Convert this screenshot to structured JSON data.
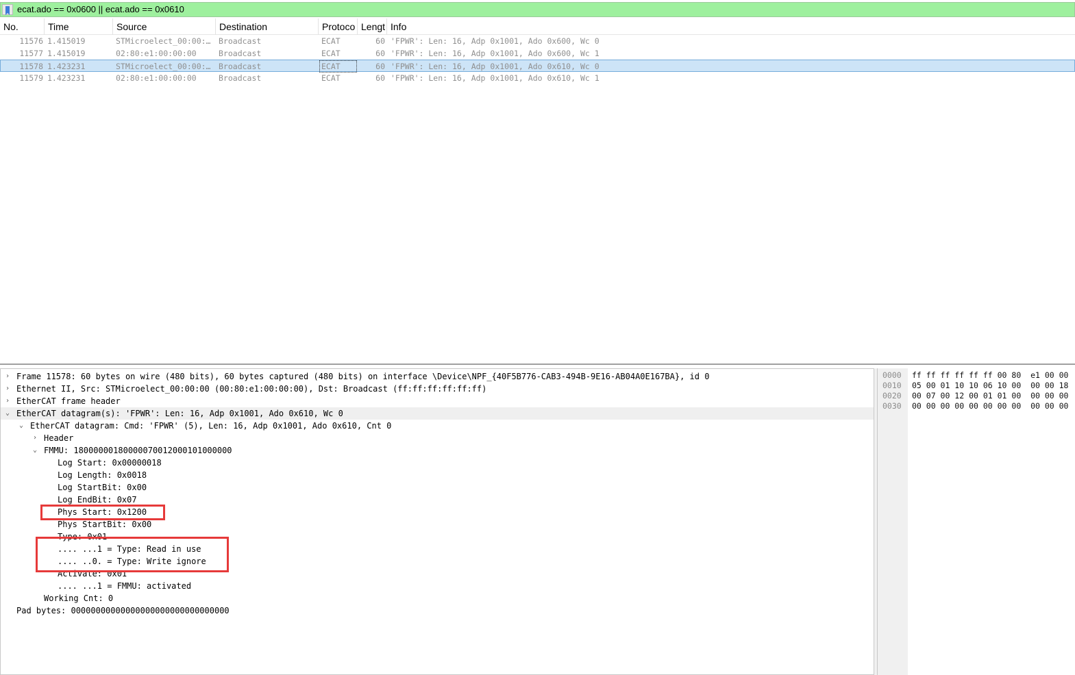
{
  "filter": {
    "value": "ecat.ado == 0x0600 || ecat.ado == 0x0610"
  },
  "columns": [
    "No.",
    "Time",
    "Source",
    "Destination",
    "Protoco",
    "Lengt",
    "Info"
  ],
  "packets": [
    {
      "no": "11576",
      "time": "1.415019",
      "source": "STMicroelect_00:00:…",
      "destination": "Broadcast",
      "protocol": "ECAT",
      "length": "60",
      "info": "'FPWR': Len: 16, Adp 0x1001, Ado 0x600, Wc 0"
    },
    {
      "no": "11577",
      "time": "1.415019",
      "source": "02:80:e1:00:00:00",
      "destination": "Broadcast",
      "protocol": "ECAT",
      "length": "60",
      "info": "'FPWR': Len: 16, Adp 0x1001, Ado 0x600, Wc 1"
    },
    {
      "no": "11578",
      "time": "1.423231",
      "source": "STMicroelect_00:00:…",
      "destination": "Broadcast",
      "protocol": "ECAT",
      "length": "60",
      "info": "'FPWR': Len: 16, Adp 0x1001, Ado 0x610, Wc 0"
    },
    {
      "no": "11579",
      "time": "1.423231",
      "source": "02:80:e1:00:00:00",
      "destination": "Broadcast",
      "protocol": "ECAT",
      "length": "60",
      "info": "'FPWR': Len: 16, Adp 0x1001, Ado 0x610, Wc 1"
    }
  ],
  "tree": [
    {
      "text": "Frame 11578: 60 bytes on wire (480 bits), 60 bytes captured (480 bits) on interface \\Device\\NPF_{40F5B776-CAB3-494B-9E16-AB04A0E167BA}, id 0",
      "chevron": "›"
    },
    {
      "text": "Ethernet II, Src: STMicroelect_00:00:00 (00:80:e1:00:00:00), Dst: Broadcast (ff:ff:ff:ff:ff:ff)",
      "chevron": "›"
    },
    {
      "text": "EtherCAT frame header",
      "chevron": "›"
    },
    {
      "text": "EtherCAT datagram(s): 'FPWR': Len: 16, Adp 0x1001, Ado 0x610, Wc 0",
      "chevron": "⌄"
    },
    {
      "text": "EtherCAT datagram: Cmd: 'FPWR' (5), Len: 16, Adp 0x1001, Ado 0x610, Cnt 0",
      "chevron": "⌄"
    },
    {
      "text": "Header",
      "chevron": "›"
    },
    {
      "text": "FMMU: 18000000180000070012000101000000",
      "chevron": "⌄"
    },
    {
      "text": "Log Start: 0x00000018",
      "chevron": ""
    },
    {
      "text": "Log Length: 0x0018",
      "chevron": ""
    },
    {
      "text": "Log StartBit: 0x00",
      "chevron": ""
    },
    {
      "text": "Log EndBit: 0x07",
      "chevron": ""
    },
    {
      "text": "Phys Start: 0x1200",
      "chevron": ""
    },
    {
      "text": "Phys StartBit: 0x00",
      "chevron": ""
    },
    {
      "text": "Type: 0x01",
      "chevron": ""
    },
    {
      "text": ".... ...1 = Type: Read in use",
      "chevron": ""
    },
    {
      "text": ".... ..0. = Type: Write ignore",
      "chevron": ""
    },
    {
      "text": "Activate: 0x01",
      "chevron": ""
    },
    {
      "text": ".... ...1 = FMMU: activated",
      "chevron": ""
    },
    {
      "text": "Working Cnt: 0",
      "chevron": ""
    },
    {
      "text": "Pad bytes: 00000000000000000000000000000000",
      "chevron": ""
    }
  ],
  "bytes": {
    "offsets": [
      "0000",
      "0010",
      "0020",
      "0030"
    ],
    "hex": [
      "ff ff ff ff ff ff 00 80  e1 00 00",
      "05 00 01 10 10 06 10 00  00 00 18",
      "00 07 00 12 00 01 01 00  00 00 00",
      "00 00 00 00 00 00 00 00  00 00 00"
    ]
  },
  "colors": {
    "filter_valid": "#9ef09e",
    "selection": "#cde4f7",
    "annotation": "#e63a3a"
  },
  "icons": {
    "bookmark": "bookmark-icon",
    "expand": "chevron-right-icon",
    "collapse": "chevron-down-icon"
  }
}
